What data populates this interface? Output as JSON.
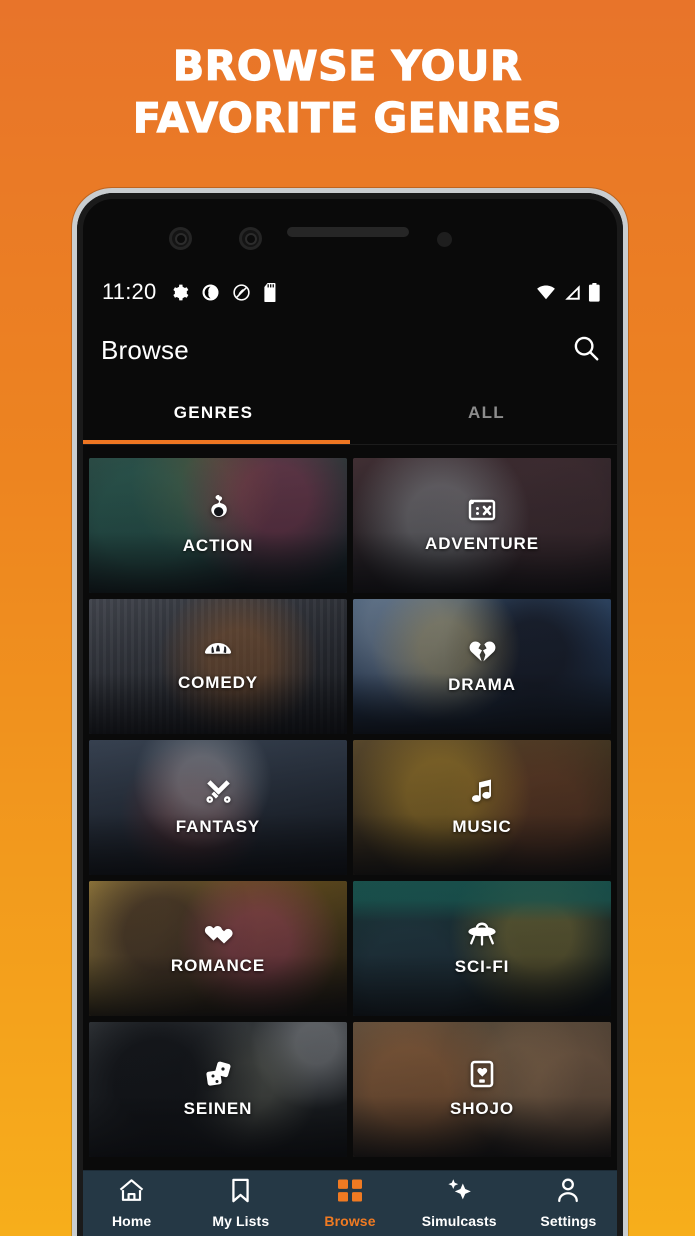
{
  "promo": {
    "headline_line1": "BROWSE YOUR",
    "headline_line2": "FAVORITE GENRES",
    "bg_top_color": "#E8742A",
    "bg_bottom_color": "#F7AE1B"
  },
  "statusbar": {
    "time": "11:20",
    "left_icons": [
      "gear-icon",
      "dark-mode-icon",
      "do-not-disturb-icon",
      "sd-card-icon"
    ],
    "right_icons": [
      "wifi-icon",
      "cell-signal-icon",
      "battery-icon"
    ]
  },
  "appbar": {
    "title": "Browse",
    "search_icon": "search-icon"
  },
  "tabs": {
    "items": [
      {
        "label": "GENRES",
        "active": true
      },
      {
        "label": "ALL",
        "active": false
      }
    ],
    "indicator_color": "#EE7622"
  },
  "genres": [
    {
      "label": "ACTION",
      "icon": "fist-icon",
      "art_a": "#3a5a52",
      "art_b": "#16232b",
      "accent": "#c4456f"
    },
    {
      "label": "ADVENTURE",
      "icon": "treasure-map-icon",
      "art_a": "#4a3a3c",
      "art_b": "#1b1618",
      "accent": "#8e8f94"
    },
    {
      "label": "COMEDY",
      "icon": "laugh-fan-icon",
      "art_a": "#4b4e58",
      "art_b": "#1d1f24",
      "accent": "#c97a3a"
    },
    {
      "label": "DRAMA",
      "icon": "broken-heart-icon",
      "art_a": "#3c5f86",
      "art_b": "#16202e",
      "accent": "#d8c07a"
    },
    {
      "label": "FANTASY",
      "icon": "sword-icon",
      "art_a": "#3e4a5c",
      "art_b": "#151a22",
      "accent": "#cfd3d8"
    },
    {
      "label": "MUSIC",
      "icon": "music-note-icon",
      "art_a": "#6a5331",
      "art_b": "#201a12",
      "accent": "#c9992f"
    },
    {
      "label": "ROMANCE",
      "icon": "two-hearts-icon",
      "art_a": "#8a6a22",
      "art_b": "#241b0f",
      "accent": "#d2557f"
    },
    {
      "label": "SCI-FI",
      "icon": "ufo-icon",
      "art_a": "#1d4a46",
      "art_b": "#0d1416",
      "accent": "#b7a04a"
    },
    {
      "label": "SEINEN",
      "icon": "dice-icon",
      "art_a": "#3b3f42",
      "art_b": "#15181a",
      "accent": "#8d8f7c"
    },
    {
      "label": "SHOJO",
      "icon": "phone-heart-icon",
      "art_a": "#6b5a48",
      "art_b": "#211b16",
      "accent": "#d1844a"
    }
  ],
  "bottomnav": {
    "background": "#253845",
    "active_color": "#F07A22",
    "items": [
      {
        "label": "Home",
        "icon": "home-icon",
        "active": false
      },
      {
        "label": "My Lists",
        "icon": "bookmark-icon",
        "active": false
      },
      {
        "label": "Browse",
        "icon": "grid-icon",
        "active": true
      },
      {
        "label": "Simulcasts",
        "icon": "sparkles-icon",
        "active": false
      },
      {
        "label": "Settings",
        "icon": "person-icon",
        "active": false
      }
    ]
  }
}
